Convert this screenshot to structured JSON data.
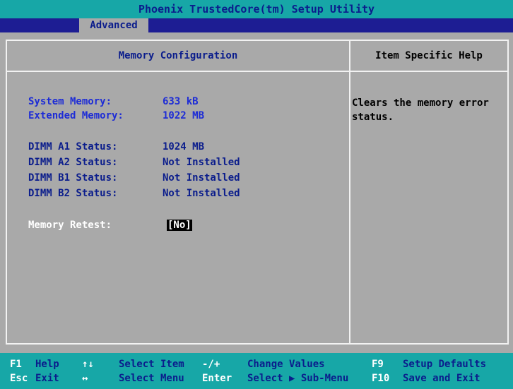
{
  "app": {
    "title": "Phoenix TrustedCore(tm) Setup Utility",
    "active_tab": "Advanced"
  },
  "panel": {
    "left_header": "Memory Configuration",
    "right_header": "Item Specific Help",
    "help_text": "Clears the memory error\nstatus."
  },
  "memory": {
    "system_label": "System Memory:",
    "system_value": "633 kB",
    "extended_label": "Extended Memory:",
    "extended_value": "1022 MB"
  },
  "dimm": [
    {
      "label": "DIMM A1 Status:",
      "value": "1024 MB"
    },
    {
      "label": "DIMM A2 Status:",
      "value": "Not Installed"
    },
    {
      "label": "DIMM B1 Status:",
      "value": "Not Installed"
    },
    {
      "label": "DIMM B2 Status:",
      "value": "Not Installed"
    }
  ],
  "retest": {
    "label": "Memory Retest:",
    "value": "[No]"
  },
  "footer": {
    "row1": [
      {
        "key": "F1",
        "action": "Help"
      },
      {
        "key": "↑↓",
        "action": "Select Item"
      },
      {
        "key": "-/+",
        "action": "Change Values"
      },
      {
        "key": "F9",
        "action": "Setup Defaults"
      }
    ],
    "row2": [
      {
        "key": "Esc",
        "action": "Exit"
      },
      {
        "key": "↔",
        "action": "Select Menu"
      },
      {
        "key": "Enter",
        "action": "Select ▶ Sub-Menu"
      },
      {
        "key": "F10",
        "action": "Save and Exit"
      }
    ]
  }
}
